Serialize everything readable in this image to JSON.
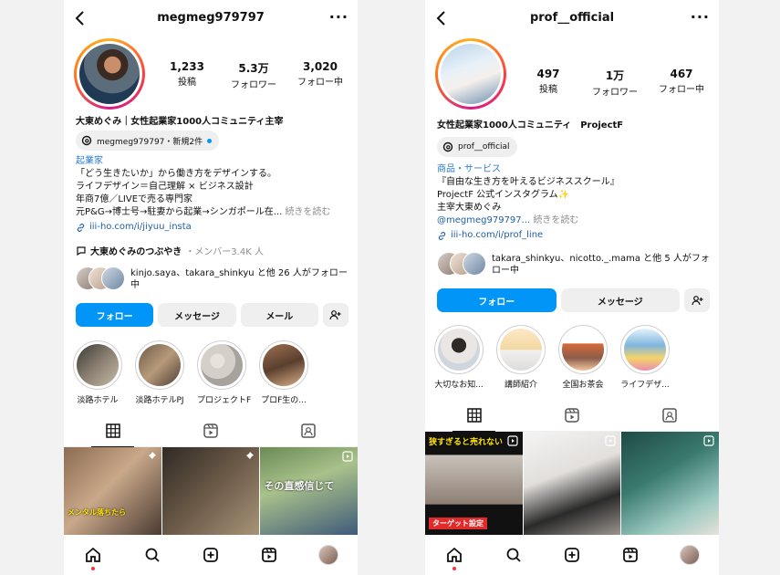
{
  "profiles": [
    {
      "username": "megmeg979797",
      "stats": [
        {
          "value": "1,233",
          "label": "投稿"
        },
        {
          "value": "5.3万",
          "label": "フォロワー"
        },
        {
          "value": "3,020",
          "label": "フォロー中"
        }
      ],
      "name": "大東めぐみ｜女性起業家1000人コミュニティ主宰",
      "threads_label": "megmeg979797・新規2件",
      "bio_category": "起業家",
      "bio_lines": [
        "「どう生きたいか」から働き方をデザインする。",
        "ライフデザイン＝自己理解 × ビジネス設計",
        "年商7億／LIVEで売る専門家"
      ],
      "bio_last_line": "元P&G→博士号→駐妻から起業→シンガポール在...",
      "more_label": "続きを読む",
      "link": "iii-ho.com/i/jiyuu_insta",
      "community_name": "大東めぐみのつぶやき",
      "community_members": "・メンバー3.4K 人",
      "followed_by": "kinjo.saya、takara_shinkyu と他 26 人がフォロー中",
      "buttons": {
        "follow": "フォロー",
        "message": "メッセージ",
        "email": "メール"
      },
      "highlights": [
        "淡路ホテル",
        "淡路ホテルPJ",
        "プロジェクトF",
        "プロF生の..."
      ],
      "grid_captions": [
        "メンタル落ちたら",
        "その直感信じて"
      ]
    },
    {
      "username": "prof__official",
      "stats": [
        {
          "value": "497",
          "label": "投稿"
        },
        {
          "value": "1万",
          "label": "フォロワー"
        },
        {
          "value": "467",
          "label": "フォロー中"
        }
      ],
      "name": "女性起業家1000人コミュニティ　ProjectF",
      "threads_label": "prof__official",
      "bio_category": "商品・サービス",
      "bio_lines": [
        "『自由な生き方を叶えるビジネススクール』",
        "ProjectF 公式インスタグラム✨",
        "主宰大東めぐみ"
      ],
      "bio_mention": "@megmeg979797...",
      "more_label": "続きを読む",
      "link": "iii-ho.com/i/prof_line",
      "followed_by": "takara_shinkyu、nicotto._.mama と他 5 人がフォロー中",
      "buttons": {
        "follow": "フォロー",
        "message": "メッセージ"
      },
      "highlights": [
        "大切なお知...",
        "講師紹介",
        "全国お茶会",
        "ライフデザ..."
      ],
      "grid_captions": [
        "狭すぎると売れない",
        "ターゲット設定"
      ]
    }
  ],
  "colors": {
    "accent": "#0095f6",
    "link": "#1f5ea8",
    "notification_dot": "#ff3040"
  },
  "icons": [
    "back-icon",
    "more-icon",
    "threads-icon",
    "link-icon",
    "add-person-icon",
    "grid-icon",
    "reels-icon",
    "tagged-icon",
    "home-icon",
    "search-icon",
    "create-icon",
    "reels-nav-icon",
    "profile-avatar"
  ]
}
